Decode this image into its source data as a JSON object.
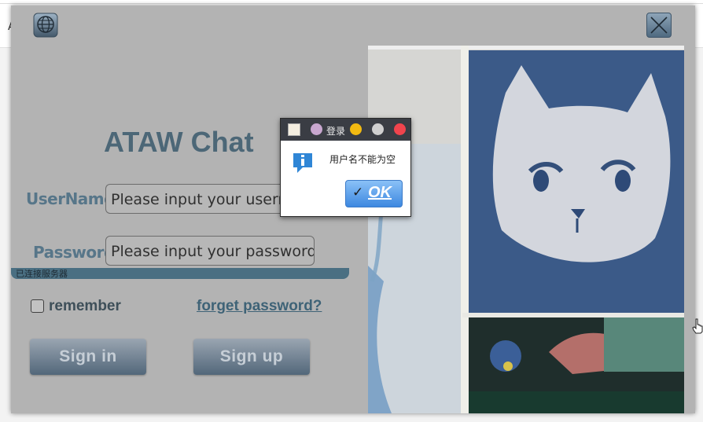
{
  "app": {
    "title": "ATAW Chat",
    "username_label": "UserName",
    "username_placeholder": "Please input your username",
    "password_label": "Password",
    "password_placeholder": "Please input your password",
    "status_text": "已连接服务器",
    "remember_label": "remember",
    "remember_checked": false,
    "forget_link": "forget password?",
    "signin_label": "Sign in",
    "signup_label": "Sign up",
    "globe_icon": "globe-icon",
    "close_icon": "close-x-icon"
  },
  "dialog": {
    "title": "登录",
    "message": "用户名不能为空",
    "ok_label": "OK",
    "info_icon": "info-icon"
  },
  "desktop": {
    "left_char": "A"
  },
  "colors": {
    "title": "#4c6777",
    "labels": "#577689",
    "status_bar": "#4a6f82",
    "button_top": "#9aa5b1",
    "button_bottom": "#52677a",
    "dialog_ok": "#3d88e0",
    "traffic_min": "#f2ba11",
    "traffic_close": "#f0444d"
  }
}
